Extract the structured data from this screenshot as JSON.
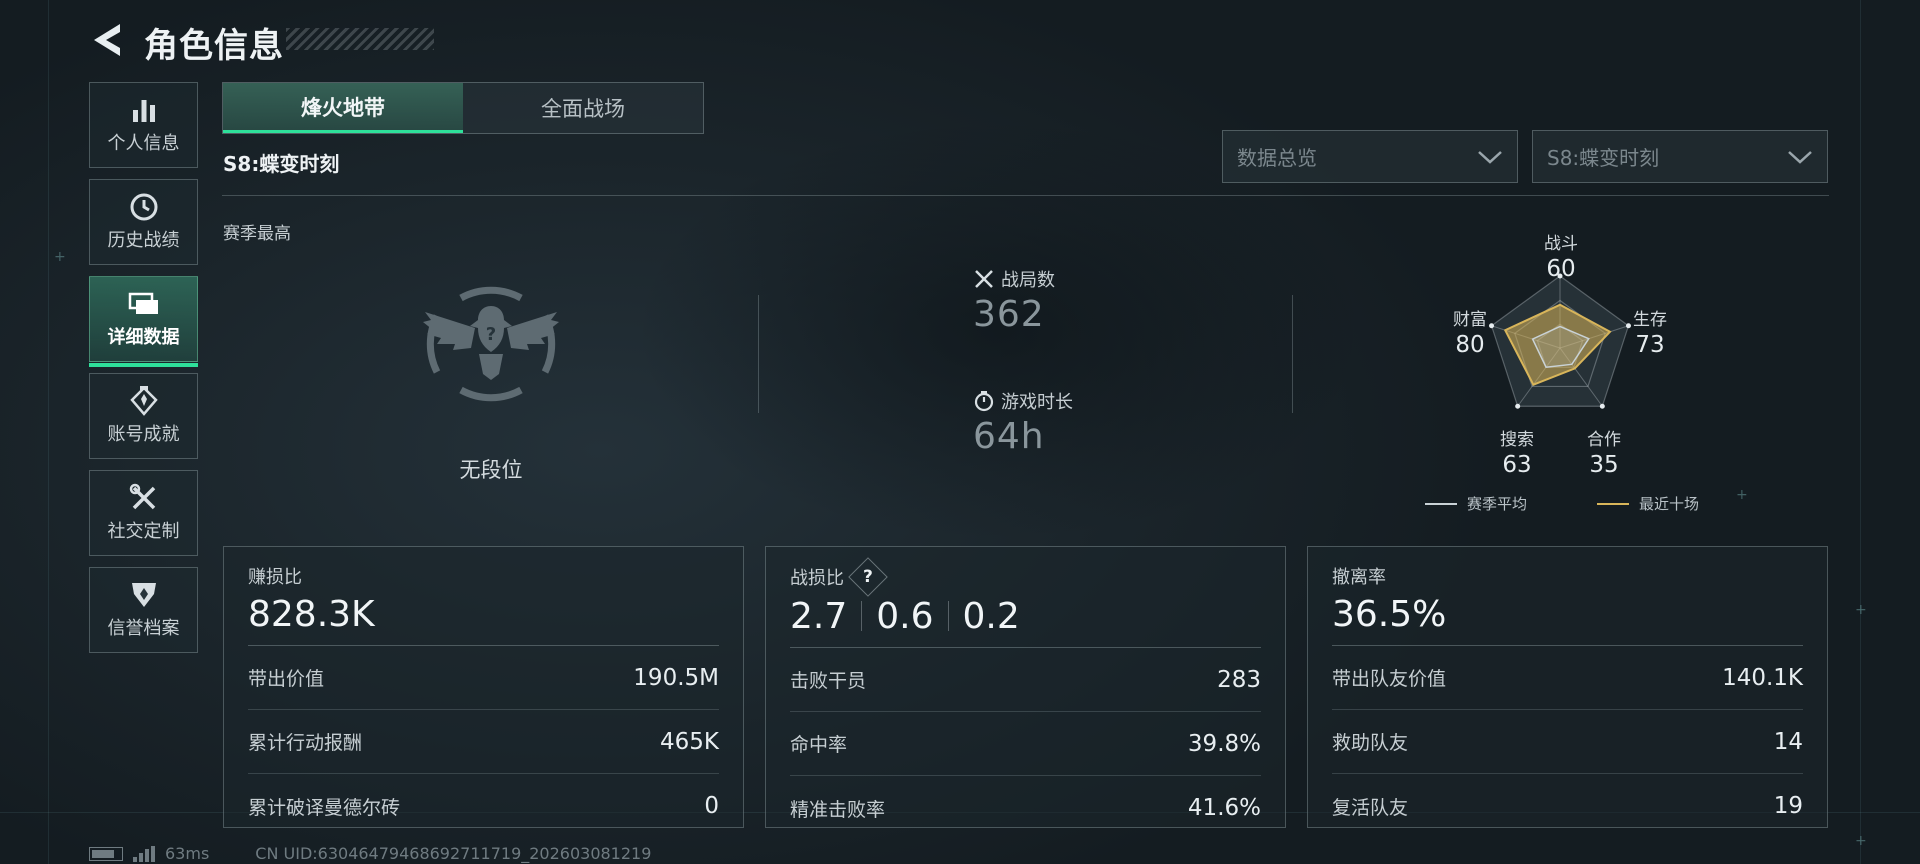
{
  "header": {
    "title": "角色信息"
  },
  "sidebar": {
    "items": [
      {
        "label": "个人信息",
        "icon": "bar-chart-icon"
      },
      {
        "label": "历史战绩",
        "icon": "history-clock-icon"
      },
      {
        "label": "详细数据",
        "icon": "folder-cards-icon",
        "active": true
      },
      {
        "label": "账号成就",
        "icon": "medal-icon"
      },
      {
        "label": "社交定制",
        "icon": "tools-icon"
      },
      {
        "label": "信誉档案",
        "icon": "shield-emblem-icon"
      }
    ]
  },
  "mode_tabs": [
    {
      "label": "烽火地带",
      "active": true
    },
    {
      "label": "全面战场",
      "active": false
    }
  ],
  "season": {
    "label": "S8:蝶变时刻"
  },
  "filters": {
    "view": "数据总览",
    "season": "S8:蝶变时刻"
  },
  "rank": {
    "section_label": "赛季最高",
    "text": "无段位"
  },
  "stats": {
    "matches": {
      "label": "战局数",
      "value": "362"
    },
    "playtime": {
      "label": "游戏时长",
      "value": "64h"
    }
  },
  "radar": {
    "axes": [
      {
        "label": "战斗",
        "value": "60"
      },
      {
        "label": "生存",
        "value": "73"
      },
      {
        "label": "合作",
        "value": "35"
      },
      {
        "label": "搜索",
        "value": "63"
      },
      {
        "label": "财富",
        "value": "80"
      }
    ],
    "season_avg_fraction": [
      0.3,
      0.42,
      0.28,
      0.33,
      0.4
    ],
    "recent_fraction": [
      0.6,
      0.73,
      0.35,
      0.63,
      0.8
    ],
    "legend": {
      "season_avg": "赛季平均",
      "recent": "最近十场"
    },
    "colors": {
      "season_avg": "#c9d2d6",
      "recent": "#d8b55a"
    }
  },
  "panels": [
    {
      "title": "赚损比",
      "big": "828.3K",
      "rows": [
        {
          "k": "带出价值",
          "v": "190.5M"
        },
        {
          "k": "累计行动报酬",
          "v": "465K"
        },
        {
          "k": "累计破译曼德尔砖",
          "v": "0"
        }
      ]
    },
    {
      "title": "战损比",
      "help": "?",
      "big_parts": [
        "2.7",
        "0.6",
        "0.2"
      ],
      "rows": [
        {
          "k": "击败干员",
          "v": "283"
        },
        {
          "k": "命中率",
          "v": "39.8%"
        },
        {
          "k": "精准击败率",
          "v": "41.6%"
        }
      ]
    },
    {
      "title": "撤离率",
      "big": "36.5%",
      "rows": [
        {
          "k": "带出队友价值",
          "v": "140.1K"
        },
        {
          "k": "救助队友",
          "v": "14"
        },
        {
          "k": "复活队友",
          "v": "19"
        }
      ]
    }
  ],
  "footer": {
    "ping": "63ms",
    "uid": "CN UID:63046479468692711719_202603081219"
  },
  "colors": {
    "accent": "#2ee09a"
  }
}
